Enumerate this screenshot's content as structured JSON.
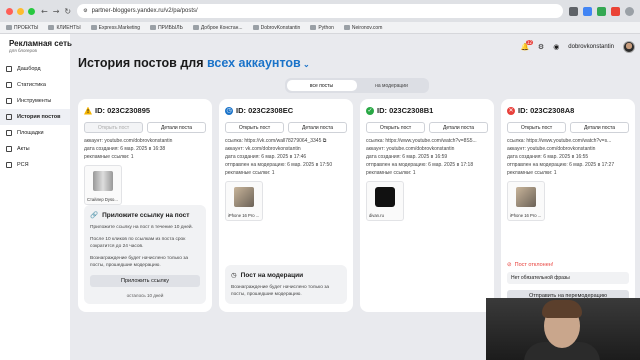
{
  "browser": {
    "url": "partner-bloggers.yandex.ru/v2/pa/posts/",
    "bookmarks": [
      "ПРОЕКТЫ",
      "КЛИЕНТЫ",
      "Express.Marketing",
      "ПРИБЫЛЬ",
      "Доброе Констан...",
      "DobrovKonstantin",
      "Python",
      "Neironov.com"
    ]
  },
  "brand": {
    "title": "Рекламная сеть",
    "subtitle": "для блогеров"
  },
  "sidebar": {
    "items": [
      {
        "label": "Дашборд",
        "icon": "dashboard-icon"
      },
      {
        "label": "Статистика",
        "icon": "stats-icon"
      },
      {
        "label": "Инструменты",
        "icon": "tools-icon"
      },
      {
        "label": "История постов",
        "icon": "history-icon",
        "active": true
      },
      {
        "label": "Площадки",
        "icon": "platforms-icon"
      },
      {
        "label": "Акты",
        "icon": "acts-icon"
      },
      {
        "label": "РСЯ",
        "icon": "rsya-icon"
      }
    ]
  },
  "topbar": {
    "notifications": "12",
    "user": "dobrovkonstantin"
  },
  "page": {
    "title": "История постов для",
    "title_accent": "всех аккаунтов"
  },
  "tabs": [
    "все посты",
    "на модерации"
  ],
  "cards": [
    {
      "id": "ID: 023C230895",
      "open_btn": "Открыть пост",
      "details_btn": "Детали поста",
      "account": "аккаунт: youtube.com/dobrovkonstantin",
      "created": "дата создания: 6 мар. 2025 в 16:38",
      "ads": "рекламные ссылки: 1",
      "product": "Стайлер Dyso...",
      "panel_title": "Приложите ссылку на пост",
      "panel_text1": "Приложите ссылку на пост в течение 10 дней.",
      "panel_text2": "После 10 кликов по ссылкам из поста срок сократится до 24 часов.",
      "panel_text3": "Вознаграждение будет начислено только за посты, прошедшие модерацию.",
      "panel_cta": "Приложить ссылку",
      "panel_hint": "осталось 10 дней"
    },
    {
      "id": "ID: 023C2308EC",
      "open_btn": "Открыть пост",
      "details_btn": "Детали поста",
      "link": "ссылка: https://vk.com/wall78279064_3345",
      "account": "аккаунт: vk.com/dobrovkonstantin",
      "created": "дата создания: 6 мар. 2025 в 17:46",
      "sent": "отправлен на модерацию: 6 мар. 2025 в 17:50",
      "ads": "рекламные ссылки: 1",
      "product": "iPhone 16 Pro ...",
      "panel_title": "Пост на модерации",
      "panel_text1": "Вознаграждение будет начислено только за посты, прошедшие модерацию."
    },
    {
      "id": "ID: 023C2308B1",
      "open_btn": "Открыть пост",
      "details_btn": "Детали поста",
      "link": "ссылка: https://www.youtube.com/watch?v=8S5...",
      "account": "аккаунт: youtube.com/dobrovkonstantin",
      "created": "дата создания: 6 мар. 2025 в 16:59",
      "sent": "отправлен на модерацию: 6 мар. 2025 в 17:18",
      "ads": "рекламные ссылки: 1",
      "product": "divan.ru"
    },
    {
      "id": "ID: 023C2308A8",
      "open_btn": "Открыть пост",
      "details_btn": "Детали поста",
      "link": "ссылка: https://www.youtube.com/watch?v=s...",
      "account": "аккаунт: youtube.com/dobrovkonstantin",
      "created": "дата создания: 6 мар. 2025 в 16:55",
      "sent": "отправлен на модерацию: 6 мар. 2025 в 17:27",
      "ads": "рекламные ссылки: 1",
      "product": "iPhone 16 Pro ...",
      "reject_title": "Пост отклонен!",
      "reject_reason": "Нет обязательной фразы",
      "reject_btn": "Отправить на перемодерацию"
    }
  ]
}
